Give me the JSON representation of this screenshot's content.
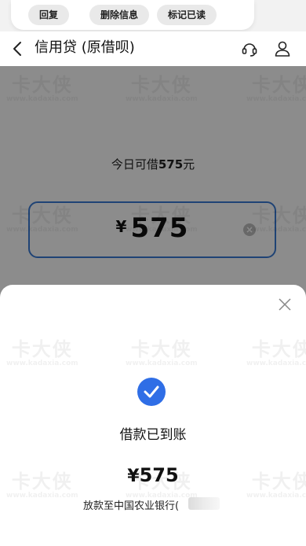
{
  "notification": {
    "actions": [
      "回复",
      "删除信息",
      "标记已读"
    ]
  },
  "header": {
    "title": "信用贷 (原借呗)",
    "icons": [
      "back-icon",
      "customer-service-icon",
      "user-icon"
    ]
  },
  "loan": {
    "available_prefix": "今日可借",
    "available_amount": "575",
    "available_suffix": "元",
    "currency": "¥",
    "input_value": "575"
  },
  "sheet": {
    "status": "借款已到账",
    "currency": "¥",
    "amount": "575",
    "destination": "放款至中国农业银行(",
    "accent_color": "#2f6ee6"
  },
  "watermark": {
    "brand": "卡大侠",
    "url": "www.kadaxia.com"
  }
}
